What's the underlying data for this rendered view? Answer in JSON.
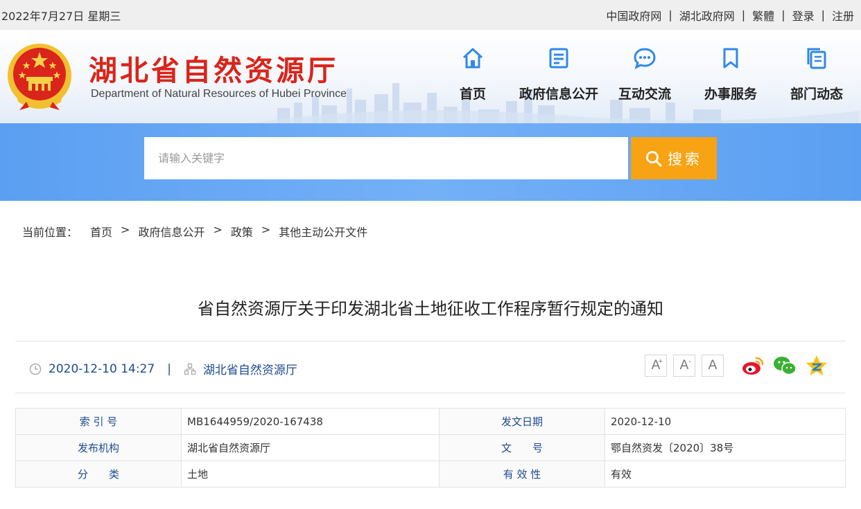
{
  "topbar": {
    "date": "2022年7月27日 星期三",
    "links": [
      "中国政府网",
      "湖北政府网",
      "繁體",
      "登录",
      "注册"
    ]
  },
  "header": {
    "title": "湖北省自然资源厅",
    "subtitle": "Department of Natural Resources of Hubei Province",
    "nav": [
      {
        "label": "首页",
        "icon": "home-icon"
      },
      {
        "label": "政府信息公开",
        "icon": "document-list-icon"
      },
      {
        "label": "互动交流",
        "icon": "chat-bubble-icon"
      },
      {
        "label": "办事服务",
        "icon": "bookmark-icon"
      },
      {
        "label": "部门动态",
        "icon": "news-copy-icon"
      }
    ]
  },
  "search": {
    "placeholder": "请输入关键字",
    "button_label": "搜索"
  },
  "breadcrumb": {
    "prefix": "当前位置：",
    "items": [
      "首页",
      "政府信息公开",
      "政策",
      "其他主动公开文件"
    ]
  },
  "article": {
    "title": "省自然资源厅关于印发湖北省土地征收工作程序暂行规定的通知",
    "datetime": "2020-12-10 14:27",
    "source": "湖北省自然资源厅",
    "font_buttons": [
      "A+",
      "A-",
      "A"
    ]
  },
  "info_table": [
    {
      "k1": "索 引 号",
      "v1": "MB1644959/2020-167438",
      "k2": "发文日期",
      "v2": "2020-12-10"
    },
    {
      "k1": "发布机构",
      "v1": "湖北省自然资源厅",
      "k2": "文　　号",
      "v2": "鄂自然资发〔2020〕38号"
    },
    {
      "k1": "分　　类",
      "v1": "土地",
      "k2": "有 效 性",
      "v2": "有效"
    }
  ],
  "colors": {
    "title_red": "#d9251b",
    "nav_blue": "#2f88e8",
    "band_blue": "#5b9ff2",
    "search_orange": "#f7a313",
    "meta_blue": "#1e4b8f"
  }
}
